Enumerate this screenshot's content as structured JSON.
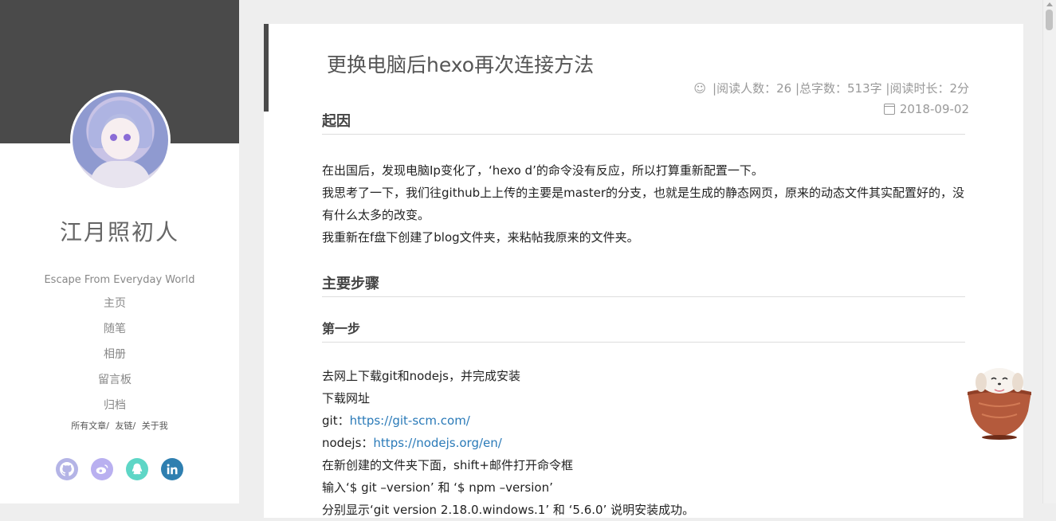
{
  "sidebar": {
    "title": "江月照初人",
    "subtitle": "Escape From Everyday World",
    "nav": [
      "主页",
      "随笔",
      "相册",
      "留言板",
      "归档"
    ],
    "subnav": [
      "所有文章/",
      "友链/",
      "关于我"
    ],
    "socials": [
      {
        "icon": "github-icon",
        "color": "#b4b4e6"
      },
      {
        "icon": "weibo-icon",
        "color": "#b9b0f0"
      },
      {
        "icon": "qq-icon",
        "color": "#5ed6c6"
      },
      {
        "icon": "linkedin-icon",
        "color": "#2f7fb0"
      }
    ]
  },
  "post": {
    "title": "更换电脑后hexo再次连接方法",
    "meta": "|阅读人数：26 |总字数：513字 |阅读时长：2分",
    "date": "2018-09-02",
    "h_origin": "起因",
    "p1": "在出国后，发现电脑Ip变化了，‘hexo d’的命令没有反应，所以打算重新配置一下。",
    "p2": "我思考了一下，我们往github上上传的主要是master的分支，也就是生成的静态网页，原来的动态文件其实配置好的，没有什么太多的改变。",
    "p3": "我重新在f盘下创建了blog文件夹，来粘帖我原来的文件夹。",
    "h_steps": "主要步骤",
    "h_step1": "第一步",
    "s1": "去网上下载git和nodejs，并完成安装",
    "s2": "下载网址",
    "git_label": "git：",
    "git_url": "https://git-scm.com/",
    "node_label": "nodejs：",
    "node_url": "https://nodejs.org/en/",
    "s3": "在新创建的文件夹下面，shift+邮件打开命令框",
    "s4": "输入‘$ git –version’ 和 ‘$ npm –version’",
    "s5": "分别显示‘git version 2.18.0.windows.1’ 和 ‘5.6.0’ 说明安装成功。"
  }
}
